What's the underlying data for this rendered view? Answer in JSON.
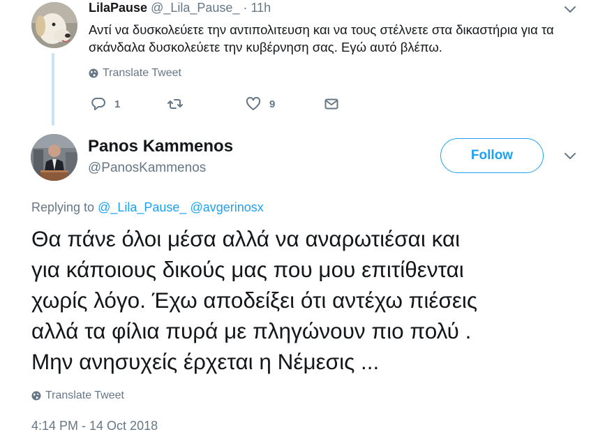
{
  "parent_tweet": {
    "name": "LilaPause",
    "handle": "@_Lila_Pause_",
    "separator": "·",
    "time": "11h",
    "text": "Αντί να δυσκολεύετε την αντιπολιτευση και να τους στέλνετε στα δικαστήρια για τα σκάνδαλα δυσκολεύετε την κυβέρνηση σας. Εγώ αυτό βλέπω.",
    "translate_label": "Translate Tweet",
    "actions": {
      "reply_count": "1",
      "retweet_count": "",
      "like_count": "9"
    }
  },
  "main_tweet": {
    "name": "Panos Kammenos",
    "handle": "@PanosKammenos",
    "follow_label": "Follow",
    "replying_prefix": "Replying to",
    "mentions": [
      "@_Lila_Pause_",
      "@avgerinosx"
    ],
    "text": "Θα πάνε όλοι μέσα αλλά να αναρωτιέσαι και\nγια κάποιους δικούς μας που μου επιτίθενται\nχωρίς λόγο. Έχω αποδείξει ότι αντέχω πιέσεις\nαλλά τα φίλια πυρά με πληγώνουν πιο πολύ .\nΜην ανησυχείς έρχεται η Νέμεσις ...",
    "translate_label": "Translate Tweet",
    "timestamp": "4:14 PM - 14 Oct 2018"
  },
  "colors": {
    "accent": "#1da1f2",
    "muted_text": "#657786",
    "primary_text": "#14171a",
    "thread_line": "#c6e5f6"
  },
  "icons": {
    "menu": "chevron-down-icon",
    "translate": "globe-icon",
    "reply": "reply-icon",
    "retweet": "retweet-icon",
    "like": "heart-icon",
    "dm": "envelope-icon"
  }
}
